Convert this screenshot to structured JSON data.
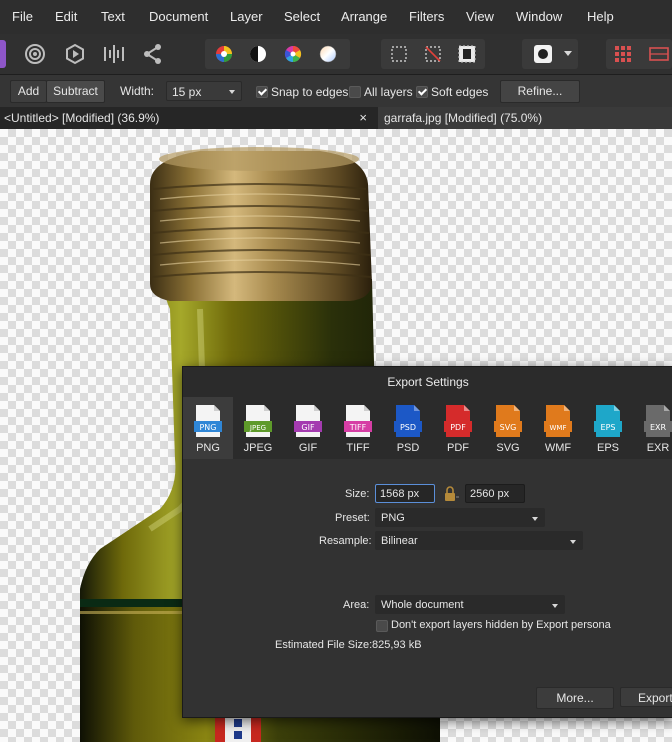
{
  "menu": [
    "File",
    "Edit",
    "Text",
    "Document",
    "Layer",
    "Select",
    "Arrange",
    "Filters",
    "View",
    "Window",
    "Help"
  ],
  "context_bar": {
    "add_label": "Add",
    "subtract_label": "Subtract",
    "width_label": "Width:",
    "width_value": "15 px",
    "snap_label": "Snap to edges",
    "snap_checked": true,
    "all_layers_label": "All layers",
    "all_layers_checked": false,
    "soft_edges_label": "Soft edges",
    "soft_edges_checked": true,
    "refine_label": "Refine..."
  },
  "tabs": [
    {
      "title": "<Untitled> [Modified] (36.9%)",
      "close": "×"
    },
    {
      "title": "garrafa.jpg [Modified] (75.0%)"
    }
  ],
  "dialog": {
    "title": "Export Settings",
    "formats": [
      {
        "badge": "PNG",
        "name": "PNG",
        "color": "#2f86d6"
      },
      {
        "badge": "JPEG",
        "name": "JPEG",
        "color": "#5e9a2a"
      },
      {
        "badge": "GIF",
        "name": "GIF",
        "color": "#a43bb0"
      },
      {
        "badge": "TIFF",
        "name": "TIFF",
        "color": "#d63ea5"
      },
      {
        "badge": "PSD",
        "name": "PSD",
        "color": "#1c58c6"
      },
      {
        "badge": "PDF",
        "name": "PDF",
        "color": "#d52b2b"
      },
      {
        "badge": "SVG",
        "name": "SVG",
        "color": "#e07a1c"
      },
      {
        "badge": "WMF",
        "name": "WMF",
        "color": "#e07a1c"
      },
      {
        "badge": "EPS",
        "name": "EPS",
        "color": "#1ea7c9"
      },
      {
        "badge": "EXR",
        "name": "EXR",
        "color": "#6a6a6a"
      }
    ],
    "selected_format": "PNG",
    "size_label": "Size:",
    "width_value": "1568 px",
    "height_value": "2560 px",
    "preset_label": "Preset:",
    "preset_value": "PNG",
    "resample_label": "Resample:",
    "resample_value": "Bilinear",
    "area_label": "Area:",
    "area_value": "Whole document",
    "hidden_layers_label": "Don't export layers hidden by Export persona",
    "hidden_layers_checked": false,
    "file_size_label": "Estimated File Size:",
    "file_size_value": "825,93 kB",
    "more_label": "More...",
    "export_label": "Export"
  },
  "colors": {
    "accent": "#5b8fd9",
    "bottle_glass": "#1f2a08",
    "olive_oil": "#6f6a0b",
    "cap_gold": "#a88b4f"
  }
}
